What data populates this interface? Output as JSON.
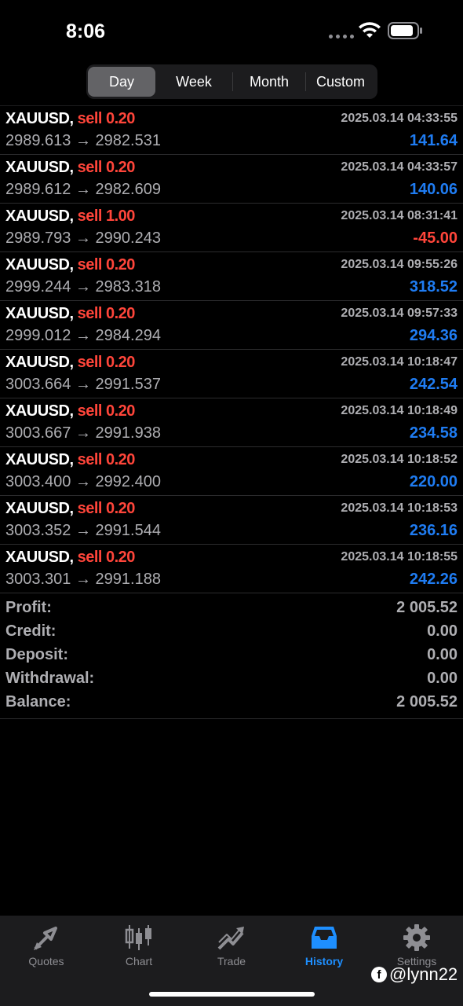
{
  "status_bar": {
    "time": "8:06"
  },
  "period_tabs": [
    {
      "label": "Day",
      "active": true
    },
    {
      "label": "Week",
      "active": false
    },
    {
      "label": "Month",
      "active": false
    },
    {
      "label": "Custom",
      "active": false
    }
  ],
  "deals": [
    {
      "symbol": "XAUUSD,",
      "type": "sell 0.20",
      "time": "2025.03.14 04:33:55",
      "open": "2989.613",
      "close": "2982.531",
      "profit": "141.64",
      "sign": "pos"
    },
    {
      "symbol": "XAUUSD,",
      "type": "sell 0.20",
      "time": "2025.03.14 04:33:57",
      "open": "2989.612",
      "close": "2982.609",
      "profit": "140.06",
      "sign": "pos"
    },
    {
      "symbol": "XAUUSD,",
      "type": "sell 1.00",
      "time": "2025.03.14 08:31:41",
      "open": "2989.793",
      "close": "2990.243",
      "profit": "-45.00",
      "sign": "neg"
    },
    {
      "symbol": "XAUUSD,",
      "type": "sell 0.20",
      "time": "2025.03.14 09:55:26",
      "open": "2999.244",
      "close": "2983.318",
      "profit": "318.52",
      "sign": "pos"
    },
    {
      "symbol": "XAUUSD,",
      "type": "sell 0.20",
      "time": "2025.03.14 09:57:33",
      "open": "2999.012",
      "close": "2984.294",
      "profit": "294.36",
      "sign": "pos"
    },
    {
      "symbol": "XAUUSD,",
      "type": "sell 0.20",
      "time": "2025.03.14 10:18:47",
      "open": "3003.664",
      "close": "2991.537",
      "profit": "242.54",
      "sign": "pos"
    },
    {
      "symbol": "XAUUSD,",
      "type": "sell 0.20",
      "time": "2025.03.14 10:18:49",
      "open": "3003.667",
      "close": "2991.938",
      "profit": "234.58",
      "sign": "pos"
    },
    {
      "symbol": "XAUUSD,",
      "type": "sell 0.20",
      "time": "2025.03.14 10:18:52",
      "open": "3003.400",
      "close": "2992.400",
      "profit": "220.00",
      "sign": "pos"
    },
    {
      "symbol": "XAUUSD,",
      "type": "sell 0.20",
      "time": "2025.03.14 10:18:53",
      "open": "3003.352",
      "close": "2991.544",
      "profit": "236.16",
      "sign": "pos"
    },
    {
      "symbol": "XAUUSD,",
      "type": "sell 0.20",
      "time": "2025.03.14 10:18:55",
      "open": "3003.301",
      "close": "2991.188",
      "profit": "242.26",
      "sign": "pos"
    }
  ],
  "arrow": "→",
  "summary": [
    {
      "label": "Profit:",
      "value": "2 005.52"
    },
    {
      "label": "Credit:",
      "value": "0.00"
    },
    {
      "label": "Deposit:",
      "value": "0.00"
    },
    {
      "label": "Withdrawal:",
      "value": "0.00"
    },
    {
      "label": "Balance:",
      "value": "2 005.52"
    }
  ],
  "bottom_tabs": [
    {
      "label": "Quotes",
      "icon": "quotes-arrows-icon",
      "active": false
    },
    {
      "label": "Chart",
      "icon": "candlestick-icon",
      "active": false
    },
    {
      "label": "Trade",
      "icon": "trend-up-icon",
      "active": false
    },
    {
      "label": "History",
      "icon": "inbox-tray-icon",
      "active": true
    },
    {
      "label": "Settings",
      "icon": "gear-icon",
      "active": false
    }
  ],
  "watermark": {
    "text": "@lynn22",
    "icon_letter": "f"
  },
  "colors": {
    "profit_positive": "#1f7cf2",
    "sell": "#ff453a",
    "active_tab": "#1e8fff",
    "inactive_tab": "#8e8e93"
  }
}
